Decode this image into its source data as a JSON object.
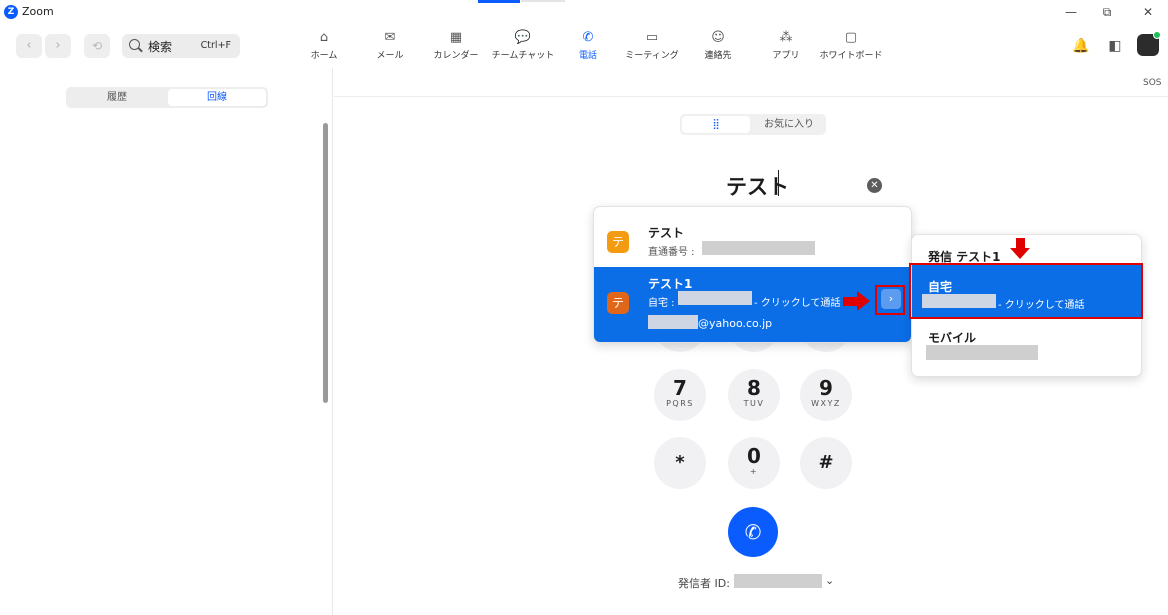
{
  "app": {
    "logo": "Z",
    "title": "Zoom"
  },
  "window": {
    "minimize": "—",
    "restore": "⧉",
    "close": "✕"
  },
  "toolbar": {
    "back": "‹",
    "forward": "›",
    "history": "⟲",
    "search_label": "検索",
    "search_shortcut": "Ctrl+F",
    "nav": [
      {
        "icon": "⌂",
        "label": "ホーム"
      },
      {
        "icon": "✉",
        "label": "メール"
      },
      {
        "icon": "▦",
        "label": "カレンダー"
      },
      {
        "icon": "💬",
        "label": "チームチャット"
      },
      {
        "icon": "✆",
        "label": "電話"
      },
      {
        "icon": "▭",
        "label": "ミーティング"
      },
      {
        "icon": "☺",
        "label": "連絡先"
      },
      {
        "icon": "⁂",
        "label": "アプリ"
      },
      {
        "icon": "▢",
        "label": "ホワイトボード"
      }
    ],
    "active_nav": "電話",
    "bell": "🔔",
    "panel_toggle": "◧"
  },
  "left_panel": {
    "tabs": [
      "履歴",
      "回線"
    ],
    "selected_tab": "回線"
  },
  "right_header": {
    "sos": "SOS"
  },
  "dialpad": {
    "tabs": {
      "keypad_icon": "⣿",
      "favorites": "お気に入り"
    },
    "input_value": "テスト",
    "clear": "✕",
    "keys": [
      {
        "digit": "7",
        "letters": "PQRS"
      },
      {
        "digit": "8",
        "letters": "TUV"
      },
      {
        "digit": "9",
        "letters": "WXYZ"
      },
      {
        "digit": "*",
        "letters": ""
      },
      {
        "digit": "0",
        "letters": "+"
      },
      {
        "digit": "#",
        "letters": ""
      }
    ],
    "call_icon": "✆",
    "caller_id_label": "発信者 ID:",
    "caller_id_chevron": "⌄"
  },
  "suggestions": [
    {
      "badge": "テ",
      "badge_color": "#f39c12",
      "name": "テスト",
      "line1_label": "直通番号 :"
    },
    {
      "badge": "テ",
      "badge_color": "#e0661a",
      "name": "テスト1",
      "line1_label": "自宅 :",
      "line1_action": "- クリックして通話",
      "email_suffix": "@yahoo.co.jp",
      "expand": "›"
    }
  ],
  "submenu": {
    "title": "発信 テスト1",
    "options": [
      {
        "name": "自宅",
        "action": "- クリックして通話"
      },
      {
        "name": "モバイル"
      }
    ]
  },
  "colors": {
    "accent": "#0b5cff",
    "highlight": "#0b6ee6",
    "annotation": "#e00000"
  }
}
